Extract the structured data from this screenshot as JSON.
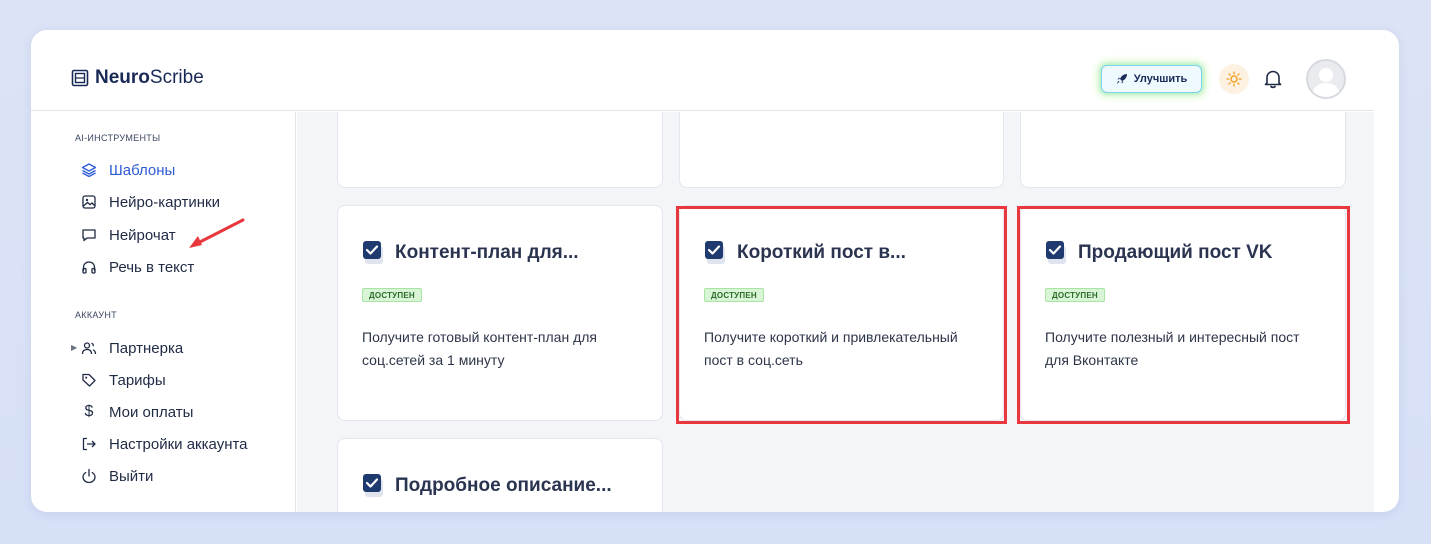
{
  "app": {
    "logo_bold": "Neuro",
    "logo_light": "Scribe",
    "upgrade_label": "Улучшить"
  },
  "sidebar": {
    "section_tools": "AI-ИНСТРУМЕНТЫ",
    "tools": [
      {
        "label": "Шаблоны",
        "icon": "layers-icon"
      },
      {
        "label": "Нейро-картинки",
        "icon": "image-icon"
      },
      {
        "label": "Нейрочат",
        "icon": "chat-icon"
      },
      {
        "label": "Речь в текст",
        "icon": "headphones-icon"
      }
    ],
    "section_account": "АККАУНТ",
    "account": [
      {
        "label": "Партнерка",
        "icon": "users-icon"
      },
      {
        "label": "Тарифы",
        "icon": "tag-icon"
      },
      {
        "label": "Мои оплаты",
        "icon": "dollar-icon"
      },
      {
        "label": "Настройки аккаунта",
        "icon": "logout-arrow-icon"
      },
      {
        "label": "Выйти",
        "icon": "power-icon"
      }
    ]
  },
  "cards": [
    {
      "title": "Контент-план для...",
      "badge": "ДОСТУПЕН",
      "desc": "Получите готовый контент-план для соц.сетей за 1 минуту"
    },
    {
      "title": "Короткий пост в...",
      "badge": "ДОСТУПЕН",
      "desc": "Получите короткий и привлекательный пост в соц.сеть"
    },
    {
      "title": "Продающий пост VK",
      "badge": "ДОСТУПЕН",
      "desc": "Получите полезный и интересный пост для Вконтакте"
    },
    {
      "title": "Подробное описание...",
      "badge": "",
      "desc": ""
    }
  ],
  "colors": {
    "accent": "#2d5bd6",
    "highlight": "#e8383e",
    "badge_bg": "#d8f5d6"
  }
}
